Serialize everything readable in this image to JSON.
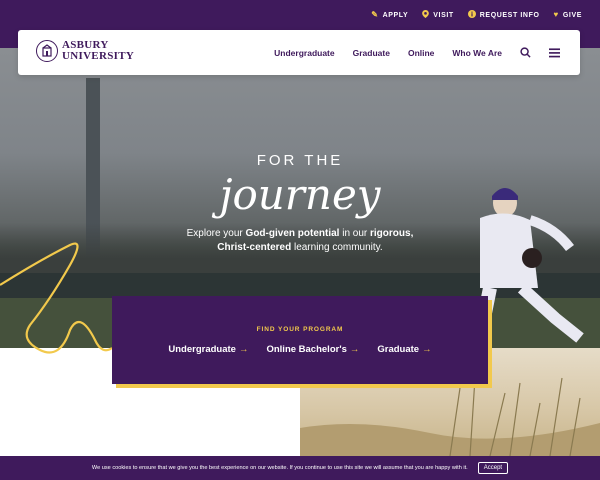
{
  "utility_nav": [
    {
      "label": "APPLY",
      "icon": "pencil-icon"
    },
    {
      "label": "VISIT",
      "icon": "map-pin-icon"
    },
    {
      "label": "REQUEST INFO",
      "icon": "info-icon"
    },
    {
      "label": "GIVE",
      "icon": "heart-icon"
    }
  ],
  "logo": {
    "line1": "ASBURY",
    "line2": "UNIVERSITY"
  },
  "main_nav": [
    "Undergraduate",
    "Graduate",
    "Online",
    "Who We Are"
  ],
  "hero": {
    "for_the": "FOR THE",
    "journey": "journey",
    "tagline_parts": {
      "p1": "Explore your ",
      "b1": "God-given potential",
      "p2": " in our ",
      "b2": "rigorous,",
      "b3": "Christ-centered",
      "p3": " learning community."
    }
  },
  "find_program": {
    "label": "FIND YOUR PROGRAM",
    "links": [
      "Undergraduate",
      "Online Bachelor's",
      "Graduate"
    ],
    "arrow": "→"
  },
  "cookie": {
    "text": "We use cookies to ensure that we give you the best experience on our website. If you continue to use this site we will assume that you are happy with it.",
    "button": "Accept"
  },
  "colors": {
    "purple": "#3f1a5c",
    "gold": "#f2c94c"
  }
}
